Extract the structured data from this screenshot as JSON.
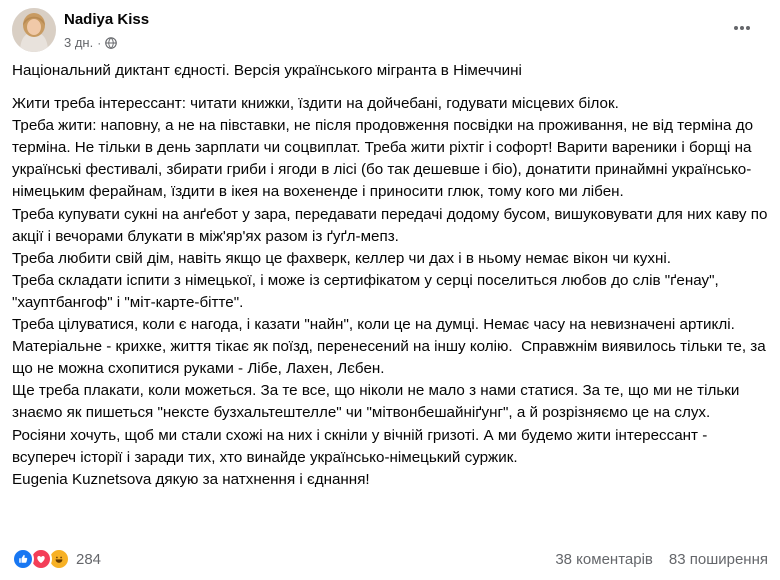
{
  "post": {
    "author": "Nadiya Kiss",
    "time": "3 дн.",
    "separator": "·",
    "title": "Національний диктант єдності. Версія українського мігранта в Німеччині",
    "paragraphs": [
      "Жити треба інтерессант: читати книжки, їздити на дойчебані, годувати місцевих білок.",
      "Треба жити: наповну, а не на півставки, не після продовження посвідки на проживання, не від термінa до термінa. Не тільки в день зарплати чи соцвиплат. Треба жити ріхтіг і софорт! Варити вареники і борщі на українські фестивалі, збирати гриби і ягоди в лісі (бо так дешевше і біо), донатити принаймні українсько-німецьким ферайнам, їздити в ікея на вохененде і приносити глюк, тому кого ми лібен.",
      "Треба купувати сукні на анґебот у зара, передавати передачі додому бусом, вишуковувати для них каву по акції і вечорами блукати в між'яр'ях разом із ґуґл-мепз.",
      "Треба любити свій дім, навіть якщо це фахверк, келлер чи дах і в ньому немає вікон чи кухні.",
      "Треба складати іспити з німецької, і може із сертифікатом у серці поселиться любов до слів \"ґенау\", \"хауптбангоф\" і \"міт-карте-бітте\".",
      "Треба цілуватися, коли є нагода, і казати \"найн\", коли це на думці. Немає часу на невизначені артиклі. Матеріальне - крихке, життя тікає як поїзд, перенесений на іншу колію.  Справжнім виявилось тільки те, за що не можна схопитися руками - Лібе, Лахен, Лєбен.",
      "Ще треба плакати, коли можеться. За те все, що ніколи не мало з нами статися. За те, що ми не тільки знаємо як пишеться \"нексте бузхальтештелле\" чи \"мітвонбешайніґунг\", а й розрізняємо це на слух.",
      "Росіяни хочуть, щоб ми стали схожі на них і скніли у вічній гризоті. А ми будемо жити інтерессант - всупереч історії і заради тих, хто винайде українсько-німецький суржик."
    ],
    "mention": "Eugenia Kuznetsova",
    "closing": " дякую за натхнення і єднання!"
  },
  "footer": {
    "reaction_count": "284",
    "reaction_icons": [
      "like-icon",
      "love-icon",
      "haha-icon"
    ],
    "comments": "38 коментарів",
    "shares": "83 поширення"
  },
  "colors": {
    "text": "#050505",
    "secondary": "#65676b",
    "like": "#1877f2",
    "love": "#f33e58",
    "haha": "#f7b125"
  }
}
